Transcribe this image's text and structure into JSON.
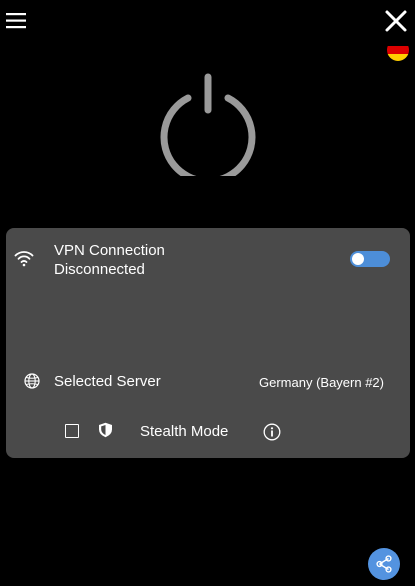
{
  "header": {
    "menu_icon": "hamburger-menu-icon",
    "close_icon": "close-icon",
    "flag_icon": "germany-flag-icon",
    "flag_colors": [
      "#000000",
      "#dd0000",
      "#ffce00"
    ]
  },
  "power": {
    "icon": "power-icon",
    "color": "#9a9a9a"
  },
  "connection": {
    "icon": "wifi-icon",
    "title": "VPN Connection",
    "status": "Disconnected",
    "toggle_on": false,
    "toggle_color": "#4d8ed8"
  },
  "server": {
    "icon": "globe-icon",
    "label": "Selected Server",
    "value": "Germany (Bayern #2)"
  },
  "stealth": {
    "checked": false,
    "icon": "shield-icon",
    "label": "Stealth Mode",
    "info_icon": "info-icon"
  },
  "share": {
    "icon": "share-icon",
    "color": "#5393e0"
  },
  "colors": {
    "background": "#000000",
    "panel": "#4a4a4a",
    "accent": "#4d8ed8"
  }
}
